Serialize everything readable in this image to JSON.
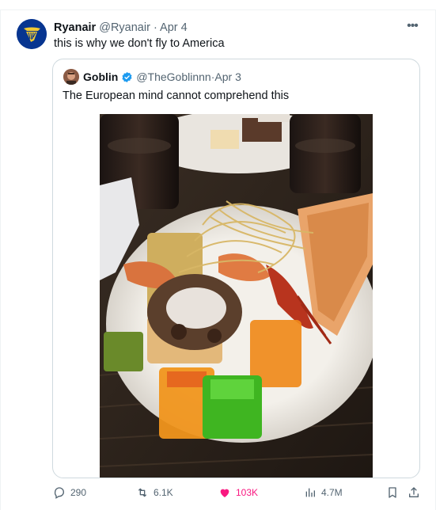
{
  "tweet": {
    "author_name": "Ryanair",
    "author_handle": "@Ryanair",
    "separator": "·",
    "date": "Apr 4",
    "text": "this is why we don't fly to America",
    "more_label": "•••"
  },
  "quoted_tweet": {
    "author_name": "Goblin",
    "author_handle": "@TheGoblinnn",
    "separator": "·",
    "date": "Apr 3",
    "text": "The European mind cannot comprehend this",
    "verified": true
  },
  "actions": {
    "replies": "290",
    "reposts": "6.1K",
    "likes": "103K",
    "views": "4.7M"
  },
  "colors": {
    "brand_blue": "#073590",
    "brand_yellow": "#f1c933",
    "like_pink": "#f91880",
    "verified_blue": "#1d9bf0",
    "muted": "#536471"
  },
  "icons": [
    "ryanair-harp-icon",
    "more-icon",
    "verified-icon",
    "reply-icon",
    "retweet-icon",
    "like-icon",
    "views-icon",
    "bookmark-icon",
    "share-icon"
  ]
}
